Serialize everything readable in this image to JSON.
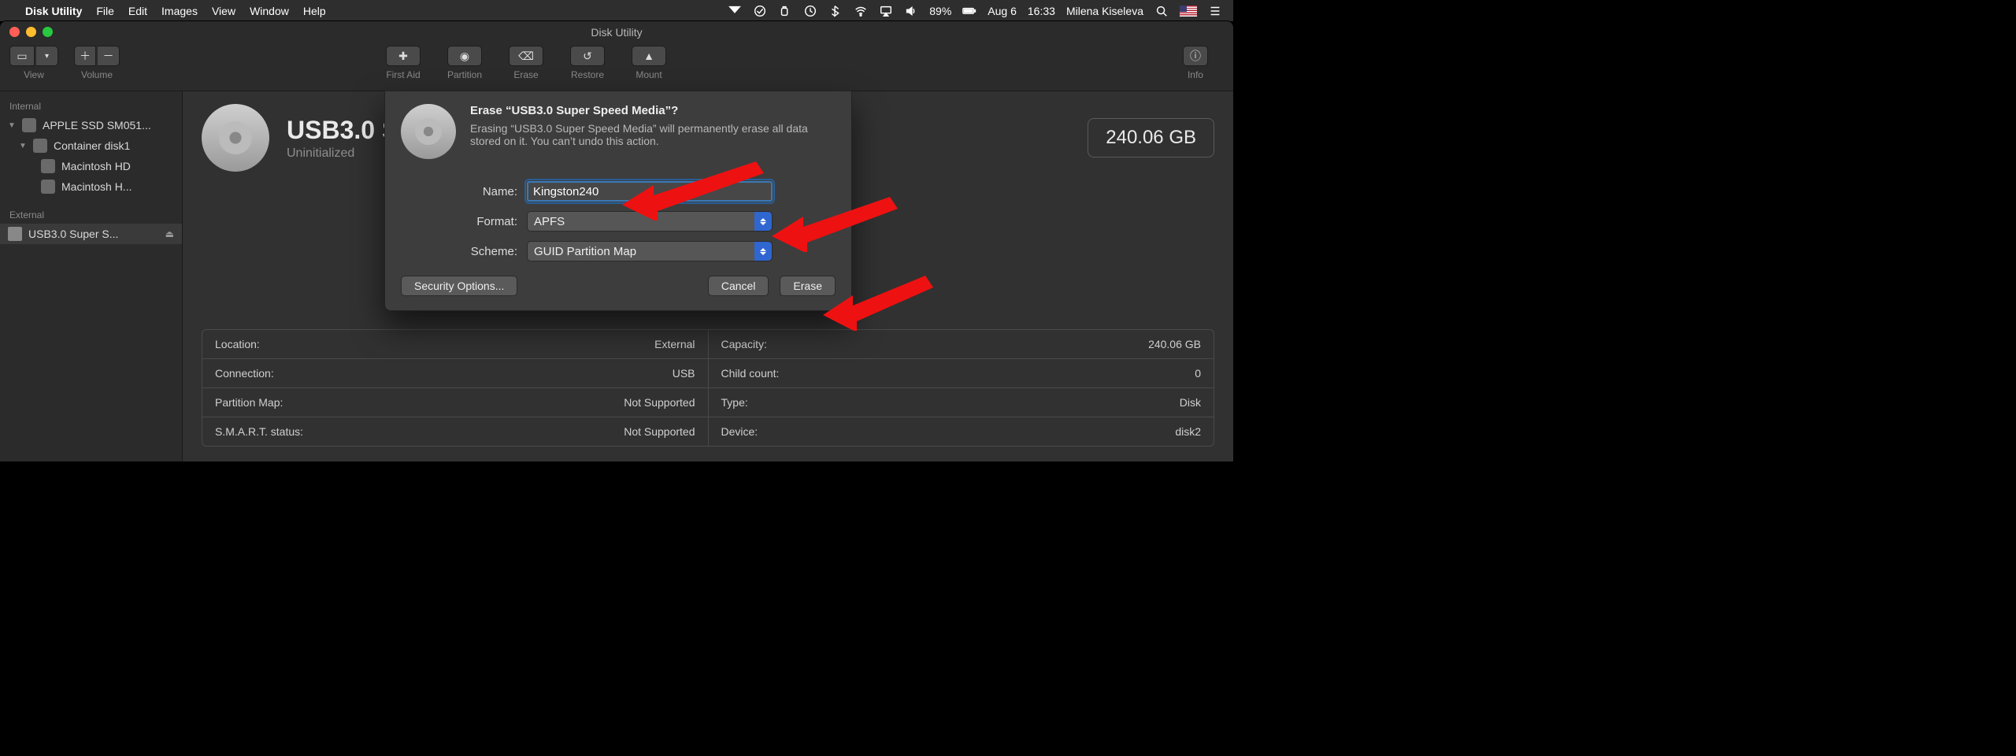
{
  "menubar": {
    "app_name": "Disk Utility",
    "items": [
      "File",
      "Edit",
      "Images",
      "View",
      "Window",
      "Help"
    ],
    "battery": "89%",
    "date": "Aug 6",
    "time": "16:33",
    "user": "Milena Kiseleva"
  },
  "window": {
    "title": "Disk Utility",
    "toolbar": {
      "view_label": "View",
      "volume_label": "Volume",
      "first_aid": "First Aid",
      "partition": "Partition",
      "erase": "Erase",
      "restore": "Restore",
      "mount": "Mount",
      "info": "Info"
    }
  },
  "sidebar": {
    "internal_label": "Internal",
    "external_label": "External",
    "internal": [
      {
        "label": "APPLE SSD SM051..."
      },
      {
        "label": "Container disk1"
      },
      {
        "label": "Macintosh HD"
      },
      {
        "label": "Macintosh H..."
      }
    ],
    "external": [
      {
        "label": "USB3.0 Super S..."
      }
    ]
  },
  "disk": {
    "title": "USB3.0 S",
    "subtitle": "Uninitialized",
    "capacity_pill": "240.06 GB"
  },
  "info": {
    "left": [
      {
        "k": "Location:",
        "v": "External"
      },
      {
        "k": "Connection:",
        "v": "USB"
      },
      {
        "k": "Partition Map:",
        "v": "Not Supported"
      },
      {
        "k": "S.M.A.R.T. status:",
        "v": "Not Supported"
      }
    ],
    "right": [
      {
        "k": "Capacity:",
        "v": "240.06 GB"
      },
      {
        "k": "Child count:",
        "v": "0"
      },
      {
        "k": "Type:",
        "v": "Disk"
      },
      {
        "k": "Device:",
        "v": "disk2"
      }
    ]
  },
  "sheet": {
    "title": "Erase “USB3.0 Super Speed Media”?",
    "desc": "Erasing “USB3.0 Super Speed Media” will permanently erase all data stored on it. You can’t undo this action.",
    "name_label": "Name:",
    "name_value": "Kingston240",
    "format_label": "Format:",
    "format_value": "APFS",
    "scheme_label": "Scheme:",
    "scheme_value": "GUID Partition Map",
    "security_btn": "Security Options...",
    "cancel_btn": "Cancel",
    "erase_btn": "Erase"
  }
}
